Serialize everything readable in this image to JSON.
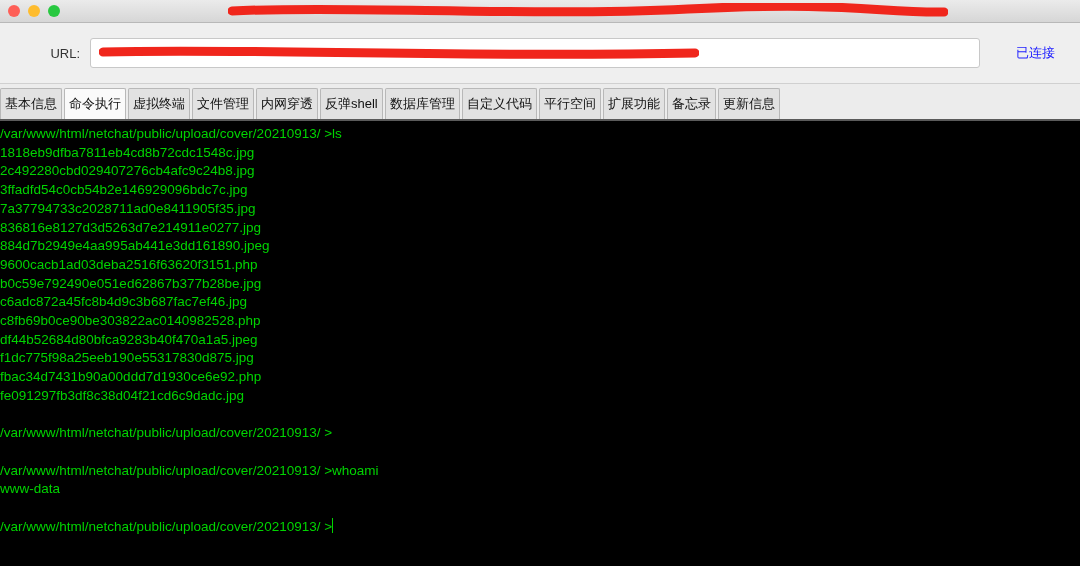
{
  "url_bar": {
    "label": "URL:",
    "status": "已连接"
  },
  "tabs": [
    {
      "label": "基本信息",
      "selected": false
    },
    {
      "label": "命令执行",
      "selected": true
    },
    {
      "label": "虚拟终端",
      "selected": false
    },
    {
      "label": "文件管理",
      "selected": false
    },
    {
      "label": "内网穿透",
      "selected": false
    },
    {
      "label": "反弹shell",
      "selected": false
    },
    {
      "label": "数据库管理",
      "selected": false
    },
    {
      "label": "自定义代码",
      "selected": false
    },
    {
      "label": "平行空间",
      "selected": false
    },
    {
      "label": "扩展功能",
      "selected": false
    },
    {
      "label": "备忘录",
      "selected": false
    },
    {
      "label": "更新信息",
      "selected": false
    }
  ],
  "terminal": {
    "blocks": [
      {
        "lines": [
          "/var/www/html/netchat/public/upload/cover/20210913/ >ls",
          "1818eb9dfba7811eb4cd8b72cdc1548c.jpg",
          "2c492280cbd029407276cb4afc9c24b8.jpg",
          "3ffadfd54c0cb54b2e146929096bdc7c.jpg",
          "7a37794733c2028711ad0e8411905f35.jpg",
          "836816e8127d3d5263d7e214911e0277.jpg",
          "884d7b2949e4aa995ab441e3dd161890.jpeg",
          "9600cacb1ad03deba2516f63620f3151.php",
          "b0c59e792490e051ed62867b377b28be.jpg",
          "c6adc872a45fc8b4d9c3b687fac7ef46.jpg",
          "c8fb69b0ce90be303822ac0140982528.php",
          "df44b52684d80bfca9283b40f470a1a5.jpeg",
          "f1dc775f98a25eeb190e55317830d875.jpg",
          "fbac34d7431b90a00ddd7d1930ce6e92.php",
          "fe091297fb3df8c38d04f21cd6c9dadc.jpg"
        ]
      },
      {
        "lines": [
          "/var/www/html/netchat/public/upload/cover/20210913/ >"
        ]
      },
      {
        "lines": [
          "/var/www/html/netchat/public/upload/cover/20210913/ >whoami",
          "www-data"
        ]
      },
      {
        "lines": [
          "/var/www/html/netchat/public/upload/cover/20210913/ >"
        ],
        "cursor": true
      }
    ]
  }
}
